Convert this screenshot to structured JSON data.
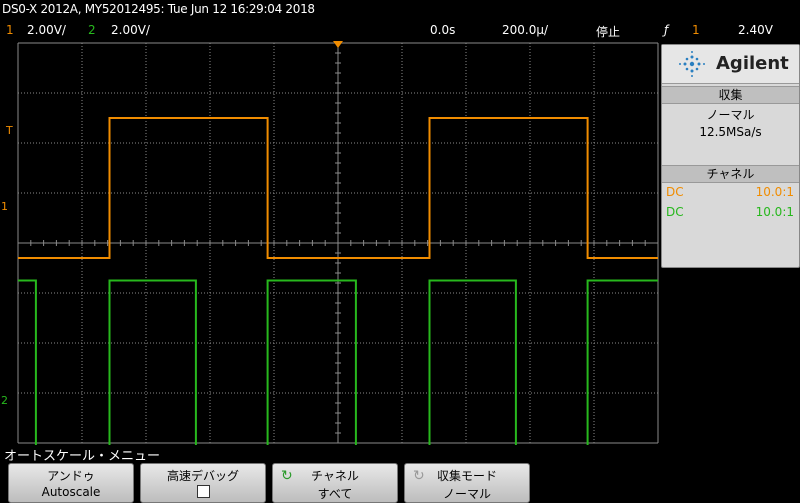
{
  "header": {
    "title": "DS0-X 2012A, MY52012495: Tue Jun 12 16:29:04 2018",
    "ch1_num": "1",
    "ch1_scale": "2.00V/",
    "ch2_num": "2",
    "ch2_scale": "2.00V/",
    "time_offset": "0.0s",
    "time_scale": "200.0µ/",
    "run_state": "停止",
    "trigger_icon": "ƒ",
    "trigger_source": "1",
    "trigger_level": "2.40V"
  },
  "markers": {
    "trigger_level": "T",
    "ch1_ground": "1",
    "ch2_ground": "2"
  },
  "side_panel": {
    "brand": "Agilent",
    "acq_header": "収集",
    "acq_mode": "ノーマル",
    "sample_rate": "12.5MSa/s",
    "ch_header": "チャネル",
    "ch1_coupling": "DC",
    "ch1_probe": "10.0:1",
    "ch2_coupling": "DC",
    "ch2_probe": "10.0:1"
  },
  "menu": {
    "title": "オートスケール・メニュー",
    "buttons": [
      {
        "line1": "アンドゥ",
        "line2": "Autoscale"
      },
      {
        "line1": "高速デバッグ",
        "line2": ""
      },
      {
        "line1": "チャネル",
        "line2": "すべて"
      },
      {
        "line1": "収集モード",
        "line2": "ノーマル"
      }
    ]
  },
  "colors": {
    "ch1": "#f08c00",
    "ch2": "#27b81d",
    "grid": "#8a8a8a"
  },
  "waveforms": {
    "ch1": {
      "shape": "square",
      "low_div": -0.3,
      "high_div": 2.5,
      "edges_div": [
        1.43,
        3.9,
        6.43,
        8.9
      ]
    },
    "ch2": {
      "shape": "square",
      "low_div": -4.15,
      "high_div": -0.75,
      "edges_div": [
        0.28,
        1.43,
        2.78,
        3.9,
        5.28,
        6.43,
        7.78,
        8.9
      ]
    }
  }
}
